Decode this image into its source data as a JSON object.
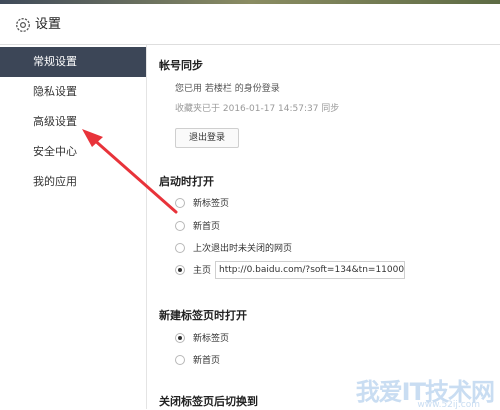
{
  "header": {
    "title": "设置",
    "icon": "gear-icon"
  },
  "sidebar": {
    "items": [
      {
        "label": "常规设置",
        "active": true
      },
      {
        "label": "隐私设置"
      },
      {
        "label": "高级设置"
      },
      {
        "label": "安全中心"
      },
      {
        "label": "我的应用"
      }
    ]
  },
  "account": {
    "title": "帐号同步",
    "logged_in": "您已用 若楼栏 的身份登录",
    "sync_time": "收藏夹已于 2016-01-17 14:57:37 同步",
    "logout_label": "退出登录"
  },
  "startup": {
    "title": "启动时打开",
    "options": [
      {
        "label": "新标签页",
        "checked": false
      },
      {
        "label": "新首页",
        "checked": false
      },
      {
        "label": "上次退出时未关闭的网页",
        "checked": false
      },
      {
        "label": "主页",
        "checked": true
      }
    ],
    "homepage_url": "http://0.baidu.com/?soft=134&tn=11000"
  },
  "newtab": {
    "title": "新建标签页时打开",
    "options": [
      {
        "label": "新标签页",
        "checked": true
      },
      {
        "label": "新首页",
        "checked": false
      }
    ]
  },
  "closetab": {
    "title": "关闭标签页后切换到"
  },
  "watermark": {
    "text": "我爱IT技术网",
    "sub": "www.52ij.com"
  },
  "colors": {
    "active_nav": "#3c4657",
    "arrow": "#e8333a"
  }
}
